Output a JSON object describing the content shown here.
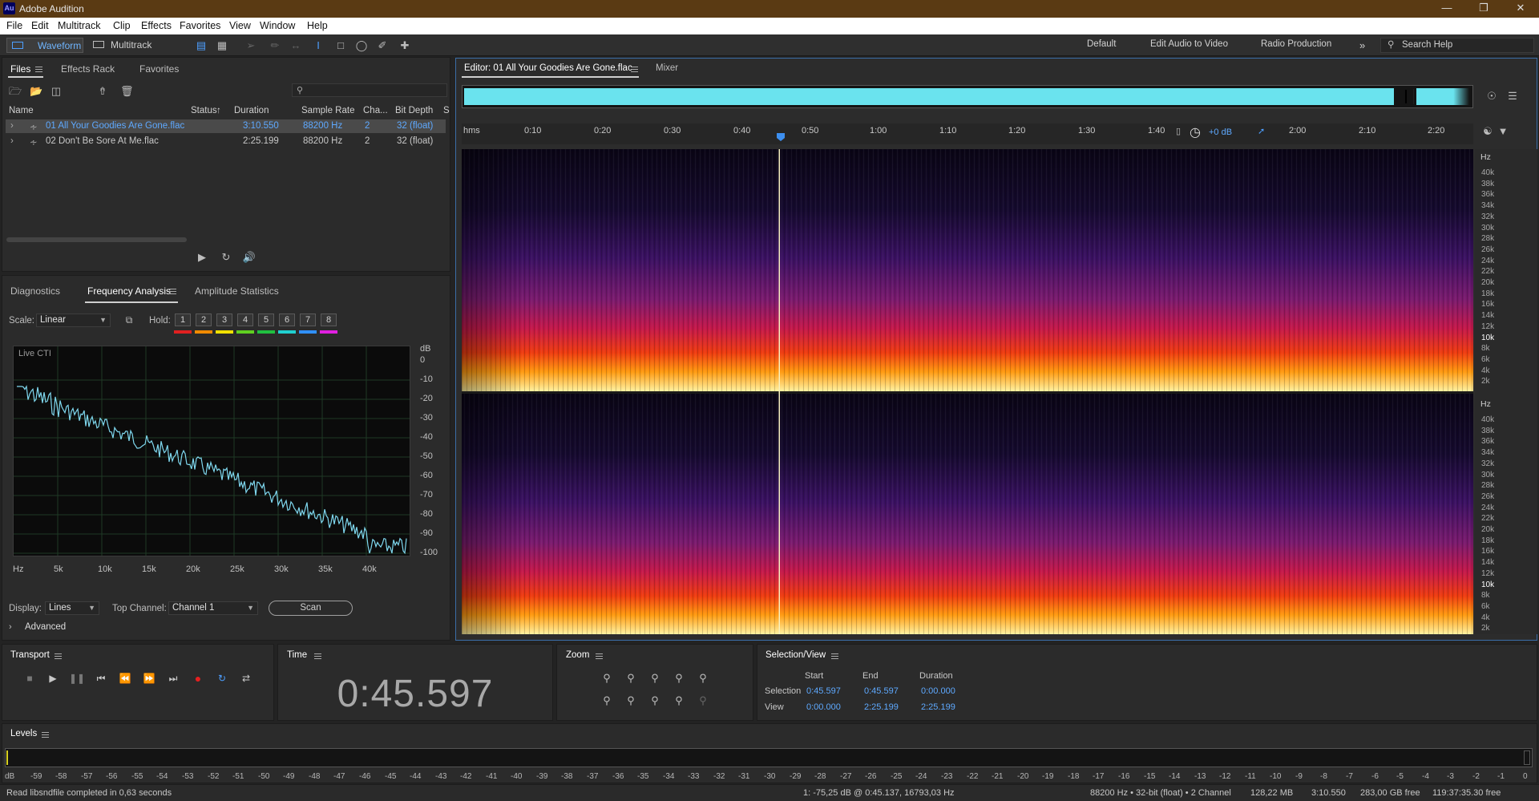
{
  "app": {
    "title": "Adobe Audition",
    "logo": "Au"
  },
  "menu": [
    "File",
    "Edit",
    "Multitrack",
    "Clip",
    "Effects",
    "Favorites",
    "View",
    "Window",
    "Help"
  ],
  "toolbar": {
    "waveform": "Waveform",
    "multitrack": "Multitrack"
  },
  "workspaces": [
    "Default",
    "Edit Audio to Video",
    "Radio Production"
  ],
  "search": {
    "placeholder": "Search Help"
  },
  "files_panel": {
    "tabs": [
      "Files",
      "Effects Rack",
      "Favorites"
    ],
    "columns": {
      "name": "Name",
      "status": "Status",
      "duration": "Duration",
      "sample_rate": "Sample Rate",
      "channels": "Cha...",
      "bit_depth": "Bit Depth",
      "extra": "S"
    },
    "search_placeholder": "",
    "rows": [
      {
        "name": "01 All Your Goodies Are Gone.flac",
        "duration": "3:10.550",
        "sample_rate": "88200 Hz",
        "channels": "2",
        "bit_depth": "32 (float)"
      },
      {
        "name": "02 Don't Be Sore At Me.flac",
        "duration": "2:25.199",
        "sample_rate": "88200 Hz",
        "channels": "2",
        "bit_depth": "32 (float)"
      }
    ]
  },
  "analysis_panel": {
    "tabs": [
      "Diagnostics",
      "Frequency Analysis",
      "Amplitude Statistics"
    ],
    "scale_label": "Scale:",
    "scale_value": "Linear",
    "hold_label": "Hold:",
    "hold_buttons": [
      "1",
      "2",
      "3",
      "4",
      "5",
      "6",
      "7",
      "8"
    ],
    "hold_colors": [
      "#e02020",
      "#f08a00",
      "#f0e000",
      "#60d020",
      "#20c040",
      "#20d0d0",
      "#3090ff",
      "#e020e0"
    ],
    "graph_label": "Live CTI",
    "db_unit": "dB",
    "db_ticks": [
      "0",
      "-10",
      "-20",
      "-30",
      "-40",
      "-50",
      "-60",
      "-70",
      "-80",
      "-90",
      "-100"
    ],
    "hz_ticks": [
      "Hz",
      "5k",
      "10k",
      "15k",
      "20k",
      "25k",
      "30k",
      "35k",
      "40k"
    ],
    "display_label": "Display:",
    "display_value": "Lines",
    "top_channel_label": "Top Channel:",
    "top_channel_value": "Channel 1",
    "scan_label": "Scan",
    "advanced_label": "Advanced"
  },
  "editor": {
    "tab": "Editor: 01 All Your Goodies Are Gone.flac",
    "mixer_tab": "Mixer",
    "timeline": [
      "hms",
      "0:10",
      "0:20",
      "0:30",
      "0:40",
      "0:50",
      "1:00",
      "1:10",
      "1:20",
      "1:30",
      "1:40",
      "2:00",
      "2:10",
      "2:20"
    ],
    "gain": "+0 dB",
    "hz_unit": "Hz",
    "hz_labels": [
      "40k",
      "38k",
      "36k",
      "34k",
      "32k",
      "30k",
      "28k",
      "26k",
      "24k",
      "22k",
      "20k",
      "18k",
      "16k",
      "14k",
      "12k",
      "10k",
      "8k",
      "6k",
      "4k",
      "2k"
    ],
    "playhead_fraction": 0.314
  },
  "transport": {
    "title": "Transport"
  },
  "time": {
    "title": "Time",
    "value": "0:45.597"
  },
  "zoom": {
    "title": "Zoom"
  },
  "selection": {
    "title": "Selection/View",
    "headers": [
      "Start",
      "End",
      "Duration"
    ],
    "selection_label": "Selection",
    "view_label": "View",
    "selection_values": [
      "0:45.597",
      "0:45.597",
      "0:00.000"
    ],
    "view_values": [
      "0:00.000",
      "2:25.199",
      "2:25.199"
    ]
  },
  "levels": {
    "title": "Levels",
    "scale": [
      "dB",
      "-59",
      "-58",
      "-57",
      "-56",
      "-55",
      "-54",
      "-53",
      "-52",
      "-51",
      "-50",
      "-49",
      "-48",
      "-47",
      "-46",
      "-45",
      "-44",
      "-43",
      "-42",
      "-41",
      "-40",
      "-39",
      "-38",
      "-37",
      "-36",
      "-35",
      "-34",
      "-33",
      "-32",
      "-31",
      "-30",
      "-29",
      "-28",
      "-27",
      "-26",
      "-25",
      "-24",
      "-23",
      "-22",
      "-21",
      "-20",
      "-19",
      "-18",
      "-17",
      "-16",
      "-15",
      "-14",
      "-13",
      "-12",
      "-11",
      "-10",
      "-9",
      "-8",
      "-7",
      "-6",
      "-5",
      "-4",
      "-3",
      "-2",
      "-1",
      "0"
    ]
  },
  "status": {
    "message": "Read libsndfile completed in 0,63 seconds",
    "cursor": "1: -75,25 dB @ 0:45.137, 16793,03 Hz",
    "format": "88200 Hz • 32-bit (float) • 2 Channel",
    "size": "128,22 MB",
    "duration": "3:10.550",
    "free": "283,00 GB free",
    "time_free": "119:37:35.30 free"
  }
}
